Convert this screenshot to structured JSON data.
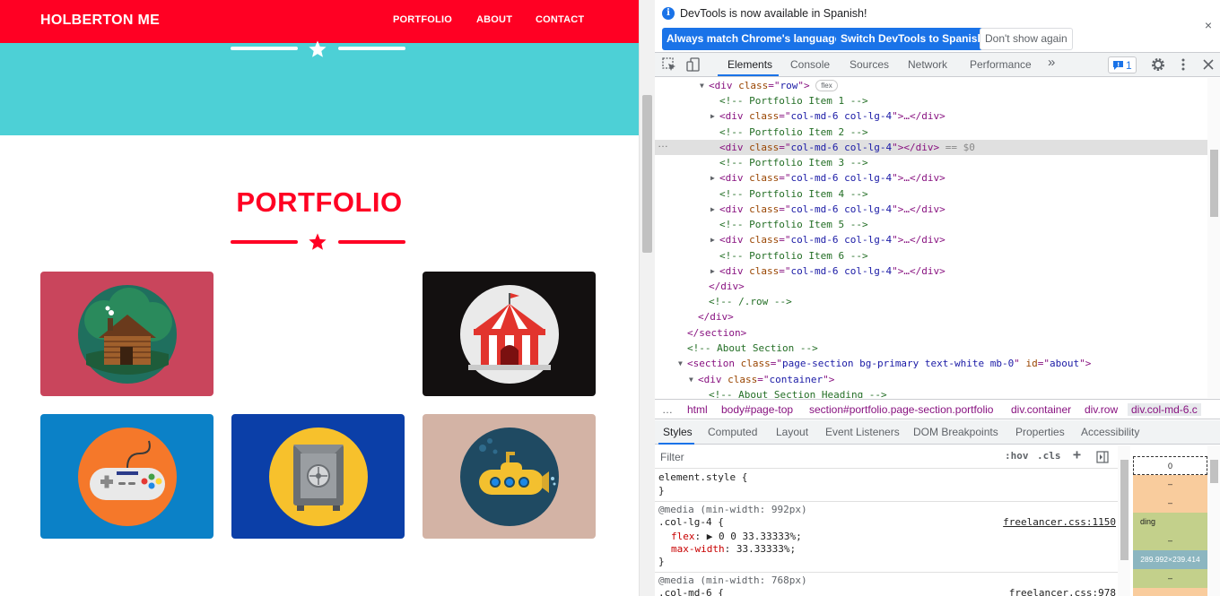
{
  "site": {
    "brand": "HOLBERTON ME",
    "nav": [
      "PORTFOLIO",
      "ABOUT",
      "CONTACT"
    ],
    "heading": "PORTFOLIO",
    "colors": {
      "primary": "#ff0023",
      "masthead": "#4dd0d6",
      "white": "#ffffff"
    },
    "tiles": [
      {
        "subject": "log-cabin",
        "bg": "#c9455c"
      },
      {
        "subject": "circus-tent",
        "bg": "#131010"
      },
      {
        "subject": "game-controller",
        "bg": "#0b81c7"
      },
      {
        "subject": "safe",
        "bg": "#0b3fa8"
      },
      {
        "subject": "submarine",
        "bg": "#d3b3a5"
      }
    ]
  },
  "devtools": {
    "infobar": {
      "message": "DevTools is now available in Spanish!",
      "buttons": [
        "Always match Chrome's language",
        "Switch DevTools to Spanish",
        "Don't show again"
      ],
      "close": "×"
    },
    "tabs": [
      "Elements",
      "Console",
      "Sources",
      "Network",
      "Performance"
    ],
    "more_tabs": "»",
    "issues_count": "1",
    "elements": {
      "lines": [
        {
          "tw": "▼",
          "p": [
            [
              "t",
              "<div "
            ],
            [
              "an",
              "class"
            ],
            [
              "t",
              "=\""
            ],
            [
              "av",
              "row"
            ],
            [
              "t",
              "\">"
            ]
          ],
          "badge": "flex"
        },
        {
          "p": [
            [
              "cm",
              "<!-- Portfolio Item 1 -->"
            ]
          ]
        },
        {
          "tw": "▶",
          "p": [
            [
              "t",
              "<div "
            ],
            [
              "an",
              "class"
            ],
            [
              "t",
              "=\""
            ],
            [
              "av",
              "col-md-6 col-lg-4"
            ],
            [
              "t",
              "\">…</div>"
            ]
          ]
        },
        {
          "p": [
            [
              "cm",
              "<!-- Portfolio Item 2 -->"
            ]
          ]
        },
        {
          "sel": true,
          "p": [
            [
              "t",
              "<div "
            ],
            [
              "an",
              "class"
            ],
            [
              "t",
              "=\""
            ],
            [
              "av",
              "col-md-6 col-lg-4"
            ],
            [
              "t",
              "\"></div>"
            ],
            [
              "dim",
              " == $0"
            ]
          ]
        },
        {
          "p": [
            [
              "cm",
              "<!-- Portfolio Item 3 -->"
            ]
          ]
        },
        {
          "tw": "▶",
          "p": [
            [
              "t",
              "<div "
            ],
            [
              "an",
              "class"
            ],
            [
              "t",
              "=\""
            ],
            [
              "av",
              "col-md-6 col-lg-4"
            ],
            [
              "t",
              "\">…</div>"
            ]
          ]
        },
        {
          "p": [
            [
              "cm",
              "<!-- Portfolio Item 4 -->"
            ]
          ]
        },
        {
          "tw": "▶",
          "p": [
            [
              "t",
              "<div "
            ],
            [
              "an",
              "class"
            ],
            [
              "t",
              "=\""
            ],
            [
              "av",
              "col-md-6 col-lg-4"
            ],
            [
              "t",
              "\">…</div>"
            ]
          ]
        },
        {
          "p": [
            [
              "cm",
              "<!-- Portfolio Item 5 -->"
            ]
          ]
        },
        {
          "tw": "▶",
          "p": [
            [
              "t",
              "<div "
            ],
            [
              "an",
              "class"
            ],
            [
              "t",
              "=\""
            ],
            [
              "av",
              "col-md-6 col-lg-4"
            ],
            [
              "t",
              "\">…</div>"
            ]
          ]
        },
        {
          "p": [
            [
              "cm",
              "<!-- Portfolio Item 6 -->"
            ]
          ]
        },
        {
          "tw": "▶",
          "p": [
            [
              "t",
              "<div "
            ],
            [
              "an",
              "class"
            ],
            [
              "t",
              "=\""
            ],
            [
              "av",
              "col-md-6 col-lg-4"
            ],
            [
              "t",
              "\">…</div>"
            ]
          ]
        },
        {
          "p": [
            [
              "t",
              "</div>"
            ]
          ]
        },
        {
          "p": [
            [
              "cm",
              "<!-- /.row -->"
            ]
          ]
        },
        {
          "p": [
            [
              "t",
              "</div>"
            ]
          ]
        },
        {
          "p": [
            [
              "t",
              "</section>"
            ]
          ]
        },
        {
          "p": [
            [
              "cm",
              "<!-- About Section -->"
            ]
          ]
        },
        {
          "tw": "▼",
          "p": [
            [
              "t",
              "<section "
            ],
            [
              "an",
              "class"
            ],
            [
              "t",
              "=\""
            ],
            [
              "av",
              "page-section bg-primary text-white mb-0"
            ],
            [
              "t",
              "\" "
            ],
            [
              "an",
              "id"
            ],
            [
              "t",
              "=\""
            ],
            [
              "av",
              "about"
            ],
            [
              "t",
              "\">"
            ]
          ]
        },
        {
          "tw": "▼",
          "p": [
            [
              "t",
              "<div "
            ],
            [
              "an",
              "class"
            ],
            [
              "t",
              "=\""
            ],
            [
              "av",
              "container"
            ],
            [
              "t",
              "\">"
            ]
          ]
        },
        {
          "p": [
            [
              "cm",
              "<!-- About Section Heading -->"
            ]
          ]
        }
      ],
      "ellipsis": "…"
    },
    "breadcrumbs": [
      "…",
      "html",
      "body#page-top",
      "section#portfolio.page-section.portfolio",
      "div.container",
      "div.row",
      "div.col-md-6.c"
    ],
    "subtabs": [
      "Styles",
      "Computed",
      "Layout",
      "Event Listeners",
      "DOM Breakpoints",
      "Properties",
      "Accessibility"
    ],
    "styles": {
      "filter_placeholder": "Filter",
      "hov": ":hov",
      "cls": ".cls",
      "plus": "+",
      "element_style": "element.style {",
      "close_brace": "}",
      "rule1": {
        "media": "@media (min-width: 992px)",
        "selector": ".col-lg-4 {",
        "source": "freelancer.css:1150",
        "decls": [
          {
            "name": "flex",
            "value": "▶ 0 0 33.33333%;"
          },
          {
            "name": "max-width",
            "value": "33.33333%;"
          }
        ]
      },
      "rule2": {
        "media": "@media (min-width: 768px)",
        "selector": ".col-md-6 {",
        "source": "freelancer.css:978"
      }
    },
    "boxmodel": [
      "0",
      "–",
      "–",
      "ding",
      "–",
      "289.992×239.414",
      "–",
      "–",
      "–"
    ]
  }
}
